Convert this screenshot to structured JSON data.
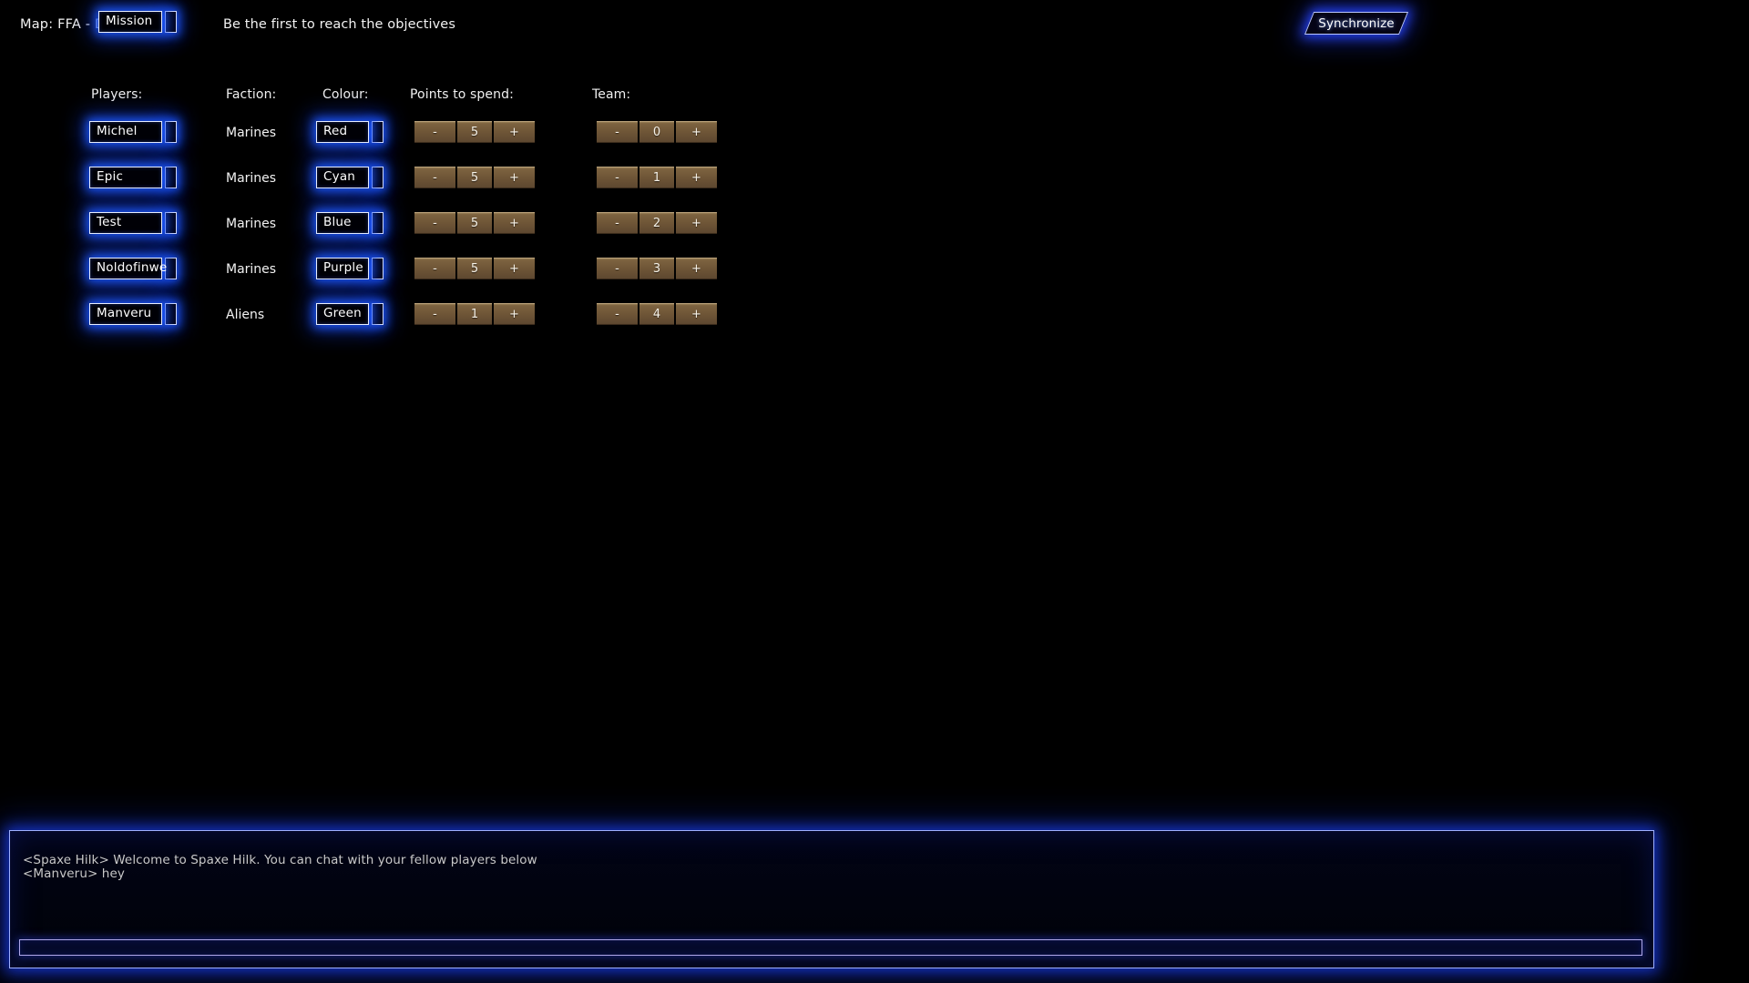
{
  "topbar": {
    "map_label": "Map: FFA - Deaths",
    "map_mode": "Mission",
    "tagline": "Be the first to reach the objectives",
    "sync_label": "Synchronize"
  },
  "table": {
    "headers": {
      "players": "Players:",
      "faction": "Faction:",
      "colour": "Colour:",
      "points": "Points to spend:",
      "team": "Team:"
    },
    "stepper": {
      "minus": "-",
      "plus": "+"
    },
    "rows": [
      {
        "name": "Michel",
        "faction": "Marines",
        "colour": "Red",
        "points": "5",
        "team": "0"
      },
      {
        "name": "Epic",
        "faction": "Marines",
        "colour": "Cyan",
        "points": "5",
        "team": "1"
      },
      {
        "name": "Test",
        "faction": "Marines",
        "colour": "Blue",
        "points": "5",
        "team": "2"
      },
      {
        "name": "Noldofinwe",
        "faction": "Marines",
        "colour": "Purple",
        "points": "5",
        "team": "3"
      },
      {
        "name": "Manveru",
        "faction": "Aliens",
        "colour": "Green",
        "points": "1",
        "team": "4"
      }
    ]
  },
  "chat": {
    "lines": [
      "<Spaxe Hilk> Welcome to Spaxe Hilk. You can chat with your fellow players below",
      "<Manveru> hey"
    ],
    "input_value": "",
    "input_placeholder": ""
  },
  "colors": {
    "background": "#000000",
    "glow_blue": "#1e5aff",
    "border_light": "#e8eeff",
    "stepper_brown": "#6d5436",
    "text_white": "#ffffff",
    "chat_text": "#c8c8c8"
  }
}
